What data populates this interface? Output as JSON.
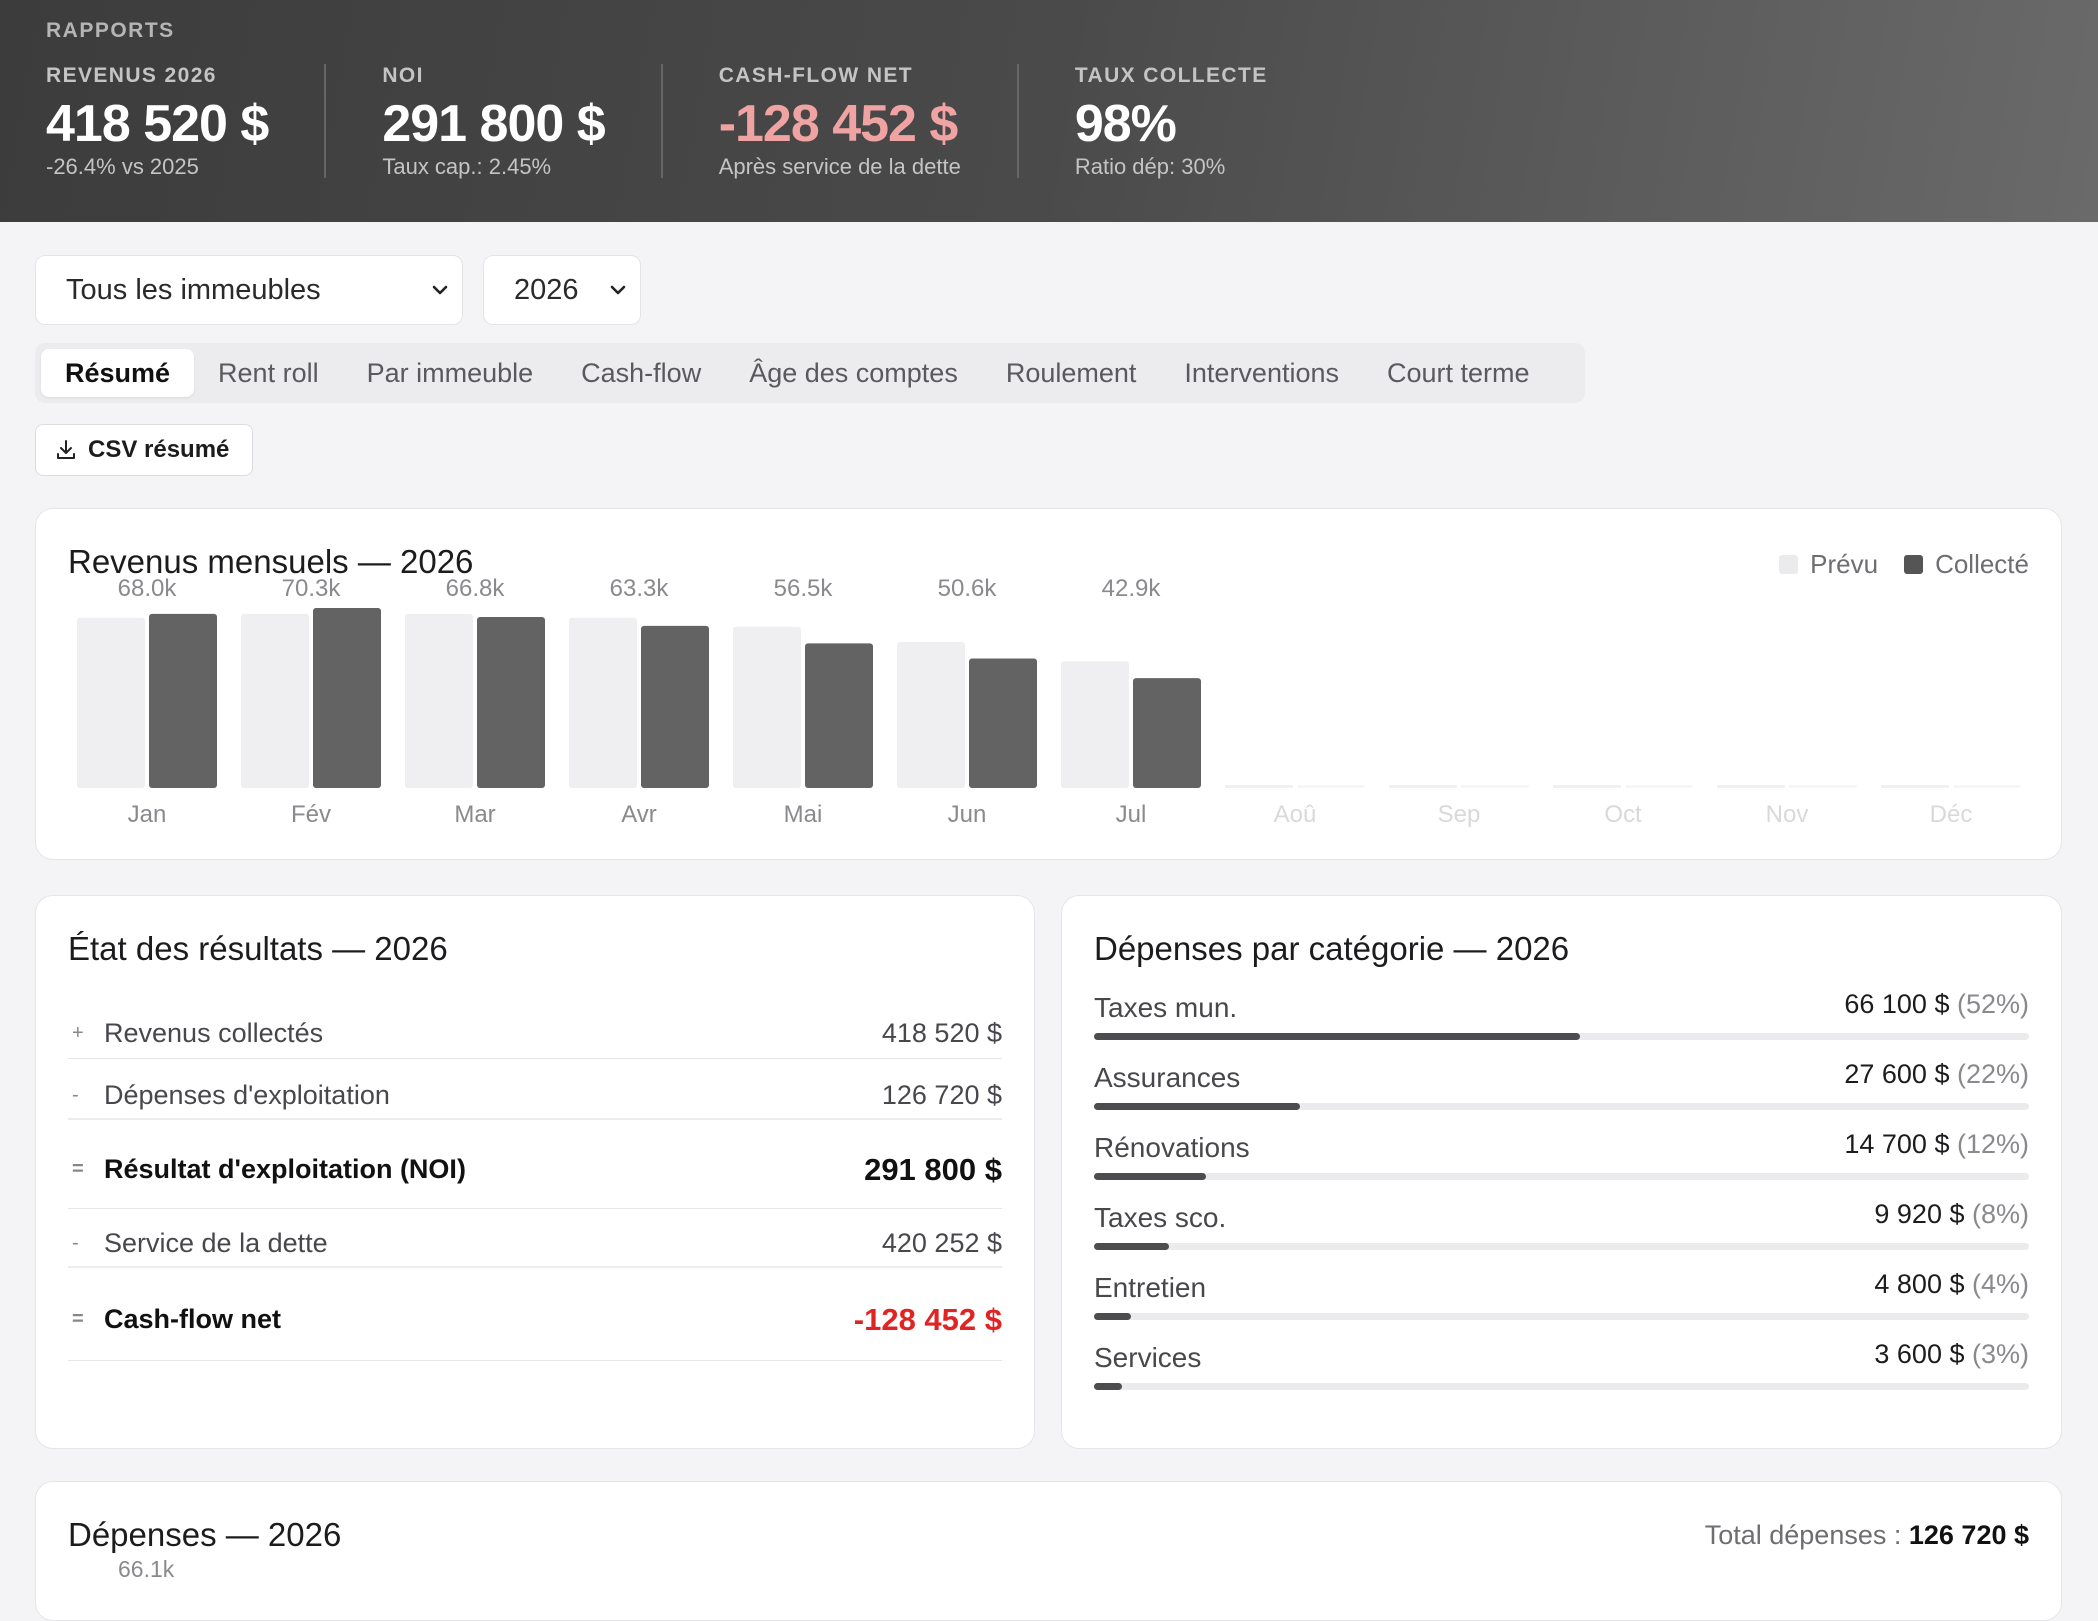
{
  "header": {
    "section_label": "RAPPORTS",
    "kpis": [
      {
        "label": "REVENUS 2026",
        "value": "418 520 $",
        "sub": "-26.4% vs 2025",
        "negative": false
      },
      {
        "label": "NOI",
        "value": "291 800 $",
        "sub": "Taux cap.: 2.45%",
        "negative": false
      },
      {
        "label": "CASH-FLOW NET",
        "value": "-128 452 $",
        "sub": "Après service de la dette",
        "negative": true
      },
      {
        "label": "TAUX COLLECTE",
        "value": "98%",
        "sub": "Ratio dép: 30%",
        "negative": false
      }
    ]
  },
  "filters": {
    "building": "Tous les immeubles",
    "year": "2026"
  },
  "tabs": [
    "Résumé",
    "Rent roll",
    "Par immeuble",
    "Cash-flow",
    "Âge des comptes",
    "Roulement",
    "Interventions",
    "Court terme"
  ],
  "active_tab": "Résumé",
  "csv_button": "CSV résumé",
  "revenue_chart": {
    "title": "Revenus mensuels — 2026",
    "legend": {
      "planned": "Prévu",
      "collected": "Collecté"
    }
  },
  "chart_data": {
    "type": "bar",
    "title": "Revenus mensuels — 2026",
    "categories": [
      "Jan",
      "Fév",
      "Mar",
      "Avr",
      "Mai",
      "Jun",
      "Jul",
      "Aoû",
      "Sep",
      "Oct",
      "Nov",
      "Déc"
    ],
    "series": [
      {
        "name": "Prévu",
        "values": [
          66.5,
          68.0,
          68.0,
          66.5,
          63.0,
          57.0,
          49.5,
          0,
          0,
          0,
          0,
          0
        ]
      },
      {
        "name": "Collecté",
        "values": [
          68.0,
          70.3,
          66.8,
          63.3,
          56.5,
          50.6,
          42.9,
          0,
          0,
          0,
          0,
          0
        ]
      }
    ],
    "data_labels": [
      "68.0k",
      "70.3k",
      "66.8k",
      "63.3k",
      "56.5k",
      "50.6k",
      "42.9k",
      "",
      "",
      "",
      "",
      ""
    ],
    "ylim": [
      0,
      70.3
    ],
    "colors": {
      "planned": "#efeff1",
      "collected": "#636363",
      "future_label": "#d9d9dc",
      "label": "#8a8a8e"
    }
  },
  "results": {
    "title": "État des résultats — 2026",
    "rows": [
      {
        "sign": "+",
        "label": "Revenus collectés",
        "amount": "418 520 $"
      },
      {
        "sign": "-",
        "label": "Dépenses d'exploitation",
        "amount": "126 720 $"
      },
      {
        "sign": "=",
        "label": "Résultat d'exploitation (NOI)",
        "amount": "291 800 $"
      },
      {
        "sign": "-",
        "label": "Service de la dette",
        "amount": "420 252 $"
      },
      {
        "sign": "=",
        "label": "Cash-flow net",
        "amount": "-128 452 $"
      }
    ]
  },
  "expenses_by_category": {
    "title": "Dépenses par catégorie — 2026",
    "items": [
      {
        "name": "Taxes mun.",
        "amount": "66 100 $",
        "pct": "(52%)",
        "share": 0.52
      },
      {
        "name": "Assurances",
        "amount": "27 600 $",
        "pct": "(22%)",
        "share": 0.22
      },
      {
        "name": "Rénovations",
        "amount": "14 700 $",
        "pct": "(12%)",
        "share": 0.12
      },
      {
        "name": "Taxes sco.",
        "amount": "9 920 $",
        "pct": "(8%)",
        "share": 0.08
      },
      {
        "name": "Entretien",
        "amount": "4 800 $",
        "pct": "(4%)",
        "share": 0.04
      },
      {
        "name": "Services",
        "amount": "3 600 $",
        "pct": "(3%)",
        "share": 0.03
      }
    ]
  },
  "expenses": {
    "title": "Dépenses — 2026",
    "total_label": "Total dépenses :",
    "total_value": "126 720 $",
    "first_label": "66.1k"
  }
}
